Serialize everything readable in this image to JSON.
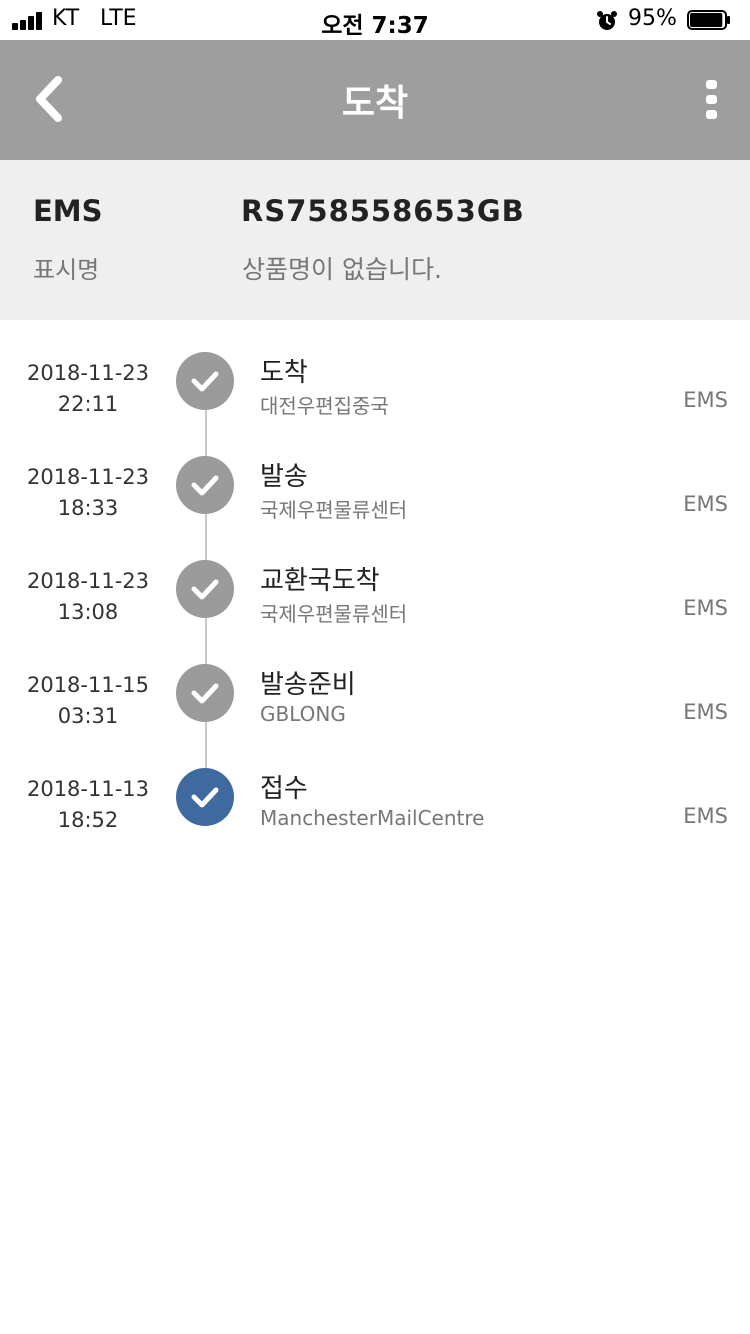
{
  "status_bar": {
    "carrier": "KT",
    "network": "LTE",
    "time": "오전 7:37",
    "battery_percent": "95%",
    "battery_level": 0.95
  },
  "nav": {
    "title": "도착",
    "back_icon": "chevron-left-icon",
    "more_icon": "more-vertical-icon"
  },
  "info": {
    "service": "EMS",
    "tracking_number": "RS758558653GB",
    "display_name_label": "표시명",
    "display_name_value": "상품명이 없습니다."
  },
  "events": [
    {
      "date": "2018-11-23",
      "time": "22:11",
      "status": "도착",
      "location": "대전우편집중국",
      "carrier": "EMS",
      "active": false
    },
    {
      "date": "2018-11-23",
      "time": "18:33",
      "status": "발송",
      "location": "국제우편물류센터",
      "carrier": "EMS",
      "active": false
    },
    {
      "date": "2018-11-23",
      "time": "13:08",
      "status": "교환국도착",
      "location": "국제우편물류센터",
      "carrier": "EMS",
      "active": false
    },
    {
      "date": "2018-11-15",
      "time": "03:31",
      "status": "발송준비",
      "location": "GBLONG",
      "carrier": "EMS",
      "active": false
    },
    {
      "date": "2018-11-13",
      "time": "18:52",
      "status": "접수",
      "location": "ManchesterMailCentre",
      "carrier": "EMS",
      "active": true
    }
  ],
  "colors": {
    "nav_bg": "#9e9e9e",
    "info_bg": "#efefef",
    "check_inactive": "#9b9b9b",
    "check_active": "#3e6aa0"
  }
}
